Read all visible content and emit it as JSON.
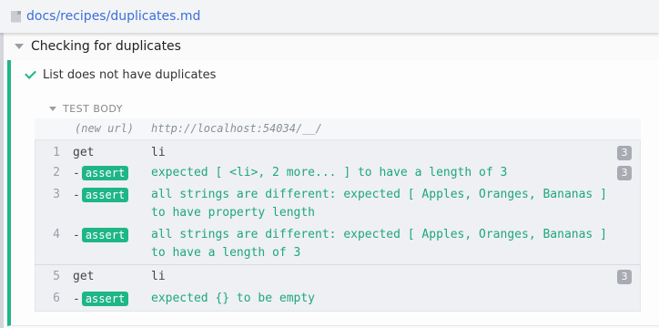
{
  "file": {
    "path": "docs/recipes/duplicates.md"
  },
  "suite": {
    "title": "Checking for duplicates"
  },
  "test": {
    "title": "List does not have duplicates",
    "status": "passed",
    "body_label": "TEST BODY",
    "new_url_label": "(new url)",
    "new_url": "http://localhost:54034/__/"
  },
  "commands": [
    {
      "num": "1",
      "kind": "get",
      "msg": "li",
      "badge": "3"
    },
    {
      "num": "2",
      "kind": "assert",
      "msg": "expected [ <li>, 2 more... ] to have a length of 3",
      "badge": "3"
    },
    {
      "num": "3",
      "kind": "assert",
      "msg_line1": "all strings are different: expected [ Apples, Oranges, Bananas ]",
      "msg_line2": "to have property length"
    },
    {
      "num": "4",
      "kind": "assert",
      "msg_line1": "all strings are different: expected [ Apples, Oranges, Bananas ]",
      "msg_line2": "to have a length of 3"
    },
    {
      "num": "5",
      "kind": "get",
      "msg": "li",
      "badge": "3"
    },
    {
      "num": "6",
      "kind": "assert",
      "msg": "expected {} to be empty"
    }
  ],
  "colors": {
    "accent": "#1fb686",
    "link": "#3a6fd8",
    "badge": "#a8abb2"
  },
  "labels": {
    "get": "get",
    "assert": "assert",
    "dash": "-"
  }
}
